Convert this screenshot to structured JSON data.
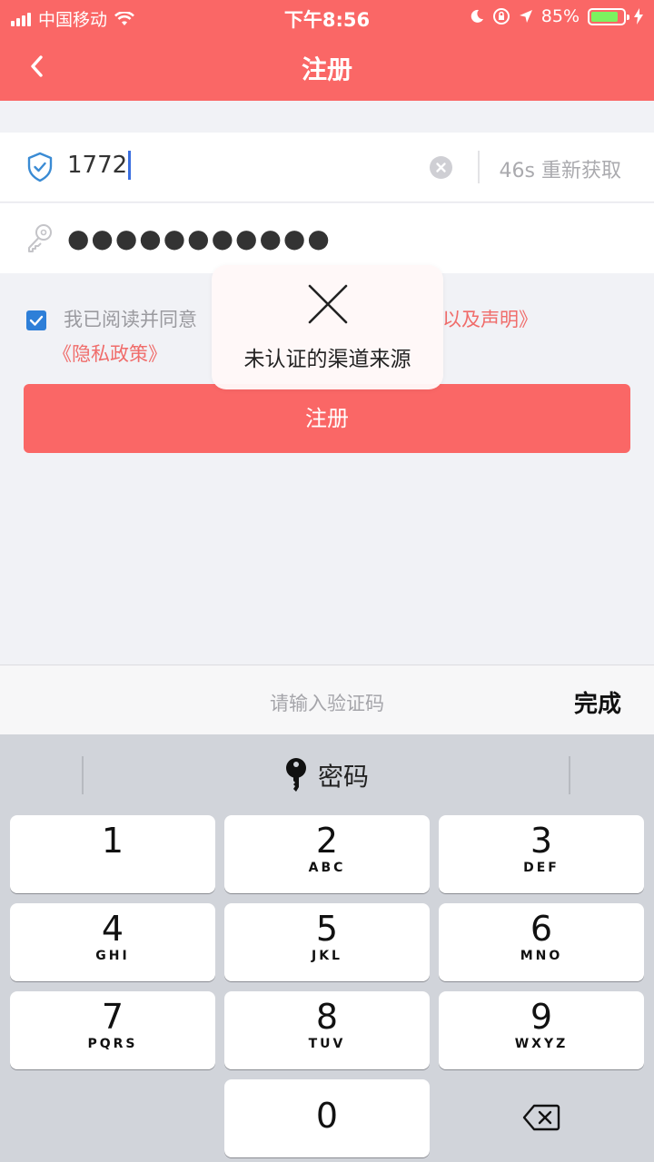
{
  "status_bar": {
    "carrier": "中国移动",
    "time": "下午8:56",
    "battery_percent": "85%",
    "battery_level": 0.85
  },
  "nav": {
    "title": "注册"
  },
  "code_field": {
    "value": "1772",
    "resend_label": "46s 重新获取"
  },
  "password_field": {
    "masked_value": "●●●●●●●●●●●"
  },
  "agreement": {
    "text": "我已阅读并同意",
    "link_terms": "以及声明》",
    "link_privacy": "《隐私政策》"
  },
  "submit_label": "注册",
  "toast": {
    "message": "未认证的渠道来源"
  },
  "keyboard_accessory": {
    "hint": "请输入验证码",
    "done_label": "完成"
  },
  "keyboard": {
    "mode_label": "密码",
    "keys": [
      {
        "num": "1",
        "letters": ""
      },
      {
        "num": "2",
        "letters": "ABC"
      },
      {
        "num": "3",
        "letters": "DEF"
      },
      {
        "num": "4",
        "letters": "GHI"
      },
      {
        "num": "5",
        "letters": "JKL"
      },
      {
        "num": "6",
        "letters": "MNO"
      },
      {
        "num": "7",
        "letters": "PQRS"
      },
      {
        "num": "8",
        "letters": "TUV"
      },
      {
        "num": "9",
        "letters": "WXYZ"
      },
      {
        "num": "0",
        "letters": ""
      }
    ]
  },
  "colors": {
    "brand": "#fa6766",
    "checkbox": "#2e7fd8",
    "link": "#f06c6a",
    "caret": "#3b6fe0"
  }
}
